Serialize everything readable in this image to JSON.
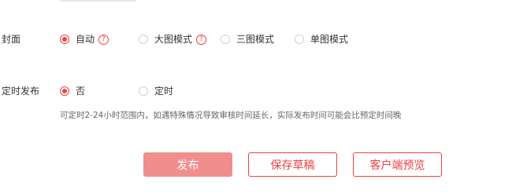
{
  "cover": {
    "label": "封面",
    "options": [
      {
        "label": "自动",
        "checked": true,
        "has_help": true
      },
      {
        "label": "大图模式",
        "checked": false,
        "has_help": true
      },
      {
        "label": "三图模式",
        "checked": false,
        "has_help": false
      },
      {
        "label": "单图模式",
        "checked": false,
        "has_help": false
      }
    ],
    "help_icon_glyph": "?"
  },
  "schedule": {
    "label": "定时发布",
    "options": [
      {
        "label": "否",
        "checked": true
      },
      {
        "label": "定时",
        "checked": false
      }
    ],
    "hint": "可定时2-24小时范围内，如遇特殊情况导致审核时间延长，实际发布时间可能会比预定时间晚"
  },
  "actions": {
    "publish_label": "发布",
    "save_draft_label": "保存草稿",
    "preview_label": "客户端预览"
  },
  "colors": {
    "accent": "#f04142",
    "primary_button_bg": "#f08e8e",
    "text": "#333333",
    "hint_text": "#666666",
    "radio_border": "#d0d0d0"
  }
}
